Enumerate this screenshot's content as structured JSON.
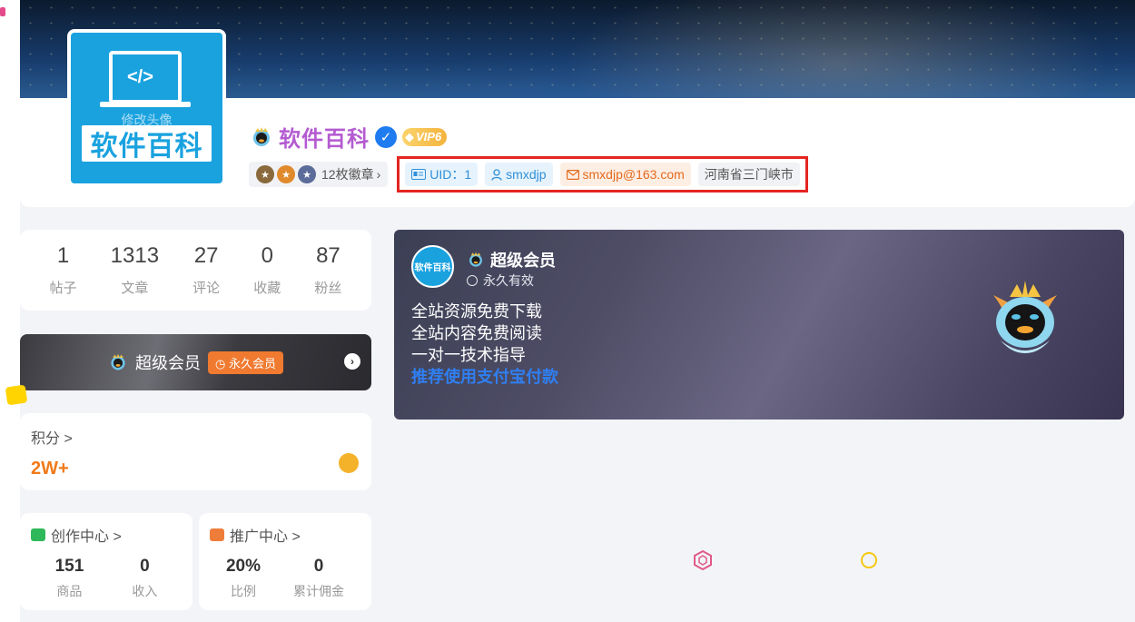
{
  "profile": {
    "avatar_brand_text": "软件百科",
    "avatar_edit_hint": "修改头像",
    "name": "软件百科",
    "vip_level": "VIP6",
    "medal_count": "12枚徽章",
    "medal_chevron": "›",
    "uid_label": "UID：1",
    "username": "smxdjp",
    "email": "smxdjp@163.com",
    "location": "河南省三门峡市",
    "highlight_color": "#e42521"
  },
  "stats": [
    {
      "value": "1",
      "label": "帖子"
    },
    {
      "value": "1313",
      "label": "文章"
    },
    {
      "value": "27",
      "label": "评论"
    },
    {
      "value": "0",
      "label": "收藏"
    },
    {
      "value": "87",
      "label": "粉丝"
    }
  ],
  "vip_bar": {
    "title": "超级会员",
    "pill": "永久会员",
    "arrow": "›"
  },
  "points": {
    "label": "积分 >",
    "value": "2W+"
  },
  "creation_center": {
    "label": "创作中心 >",
    "items": [
      {
        "value": "151",
        "label": "商品"
      },
      {
        "value": "0",
        "label": "收入"
      }
    ]
  },
  "promotion_center": {
    "label": "推广中心 >",
    "items": [
      {
        "value": "20%",
        "label": "比例"
      },
      {
        "value": "0",
        "label": "累计佣金"
      }
    ]
  },
  "membership": {
    "avatar_text": "软件百科",
    "title": "超级会员",
    "validity": "永久有效",
    "benefits": [
      "全站资源免费下载",
      "全站内容免费阅读",
      "一对一技术指导"
    ],
    "tip": "推荐使用支付宝付款"
  },
  "colors": {
    "accent_orange": "#f07a1a",
    "accent_blue": "#2f7ff2",
    "name_purple": "#b45bd1",
    "brand_blue": "#1aa2df"
  }
}
